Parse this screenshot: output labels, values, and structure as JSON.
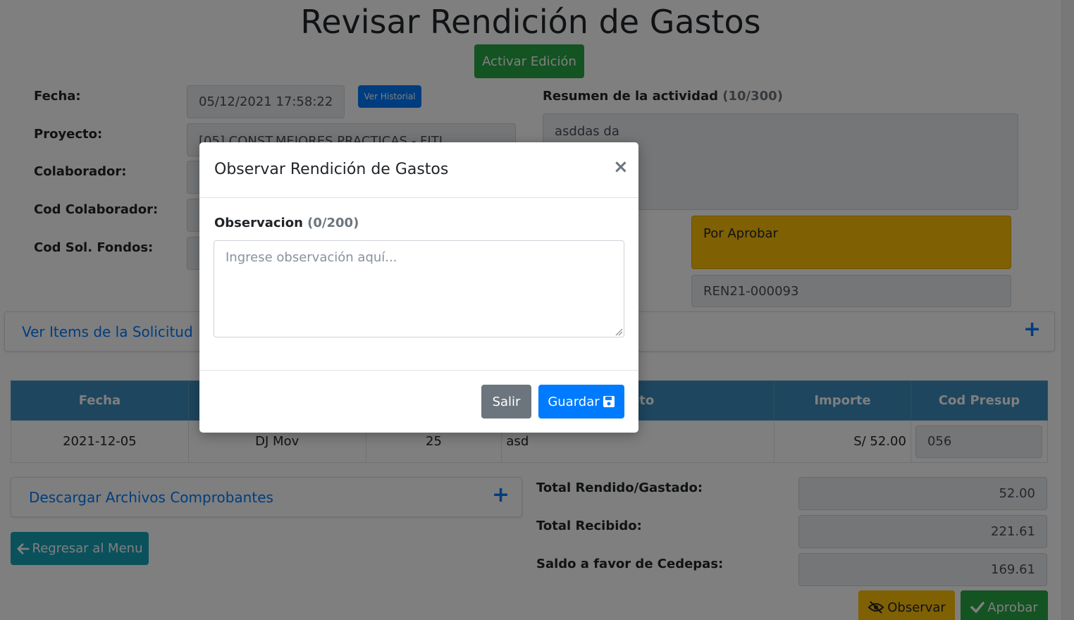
{
  "page": {
    "title": "Revisar Rendición de Gastos",
    "activate_edit_label": "Activar Edición",
    "view_history_label": "Ver Historial",
    "fields": {
      "fecha_label": "Fecha:",
      "fecha_value": "05/12/2021 17:58:22",
      "proyecto_label": "Proyecto:",
      "proyecto_value": "[05] CONST.MEJORES PRACTICAS - FITI",
      "colaborador_label": "Colaborador:",
      "cod_colaborador_label": "Cod Colaborador:",
      "cod_sol_fondos_label": "Cod Sol. Fondos:",
      "resumen_label": "Resumen de la actividad",
      "resumen_count": "(10/300)",
      "resumen_value": "asddas  da",
      "estado_value": "Por Aprobar",
      "codigo_value": "REN21-000093"
    },
    "items_section_label": "Ver Items de la Solicitud",
    "table": {
      "headers": [
        "Fecha",
        "",
        "",
        "Concepto",
        "Importe",
        "Cod Presup"
      ],
      "header_visible_concepto": "epto",
      "row": {
        "fecha": "2021-12-05",
        "tipo": "DJ Mov",
        "numero": "25",
        "concepto": "asd",
        "importe": "S/ 52.00",
        "cod_presup": "056"
      }
    },
    "download_label": "Descargar Archivos Comprobantes",
    "back_label": "Regresar al Menu",
    "totals": {
      "rendido_label": "Total Rendido/Gastado:",
      "rendido_value": "52.00",
      "recibido_label": "Total Recibido:",
      "recibido_value": "221.61",
      "saldo_label": "Saldo a favor de Cedepas:",
      "saldo_value": "169.61"
    },
    "observe_label": "Observar",
    "approve_label": "Aprobar"
  },
  "modal": {
    "title": "Observar Rendición de Gastos",
    "close_symbol": "×",
    "observacion_label": "Observacion",
    "observacion_count": "(0/200)",
    "observacion_placeholder": "Ingrese observación aquí...",
    "exit_label": "Salir",
    "save_label": "Guardar"
  },
  "colors": {
    "success": "#28a745",
    "primary": "#007bff",
    "warning": "#ffc107",
    "info": "#17a2b8",
    "table_header": "#3c8dbc"
  }
}
